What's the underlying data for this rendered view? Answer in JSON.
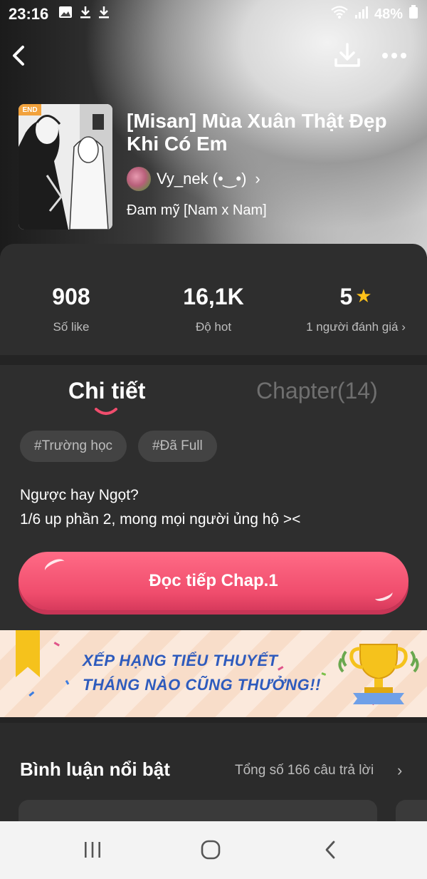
{
  "status_bar": {
    "time": "23:16",
    "battery": "48%",
    "icons": [
      "image-icon",
      "download-icon",
      "download-icon",
      "wifi-icon",
      "signal-icon",
      "lock-icon"
    ]
  },
  "topbar": {
    "icons": [
      "back-icon",
      "download-icon",
      "more-icon"
    ]
  },
  "story": {
    "cover_badge": "END",
    "title": "[Misan] Mùa Xuân Thật Đẹp Khi Có Em",
    "author": "Vy_nek (•‿•)",
    "author_chevron": "›",
    "genre": "Đam mỹ [Nam x Nam]"
  },
  "stats": {
    "likes": {
      "value": "908",
      "label": "Số like"
    },
    "hot": {
      "value": "16,1K",
      "label": "Độ hot"
    },
    "rating": {
      "value": "5",
      "star": "★",
      "label": "1 người đánh giá ›"
    }
  },
  "tabs": {
    "detail": "Chi tiết",
    "chapter": "Chapter(14)"
  },
  "tags": [
    "#Trường học",
    "#Đã Full"
  ],
  "description": {
    "line1": "Ngược hay Ngọt?",
    "line2": "1/6 up phần 2, mong mọi người ủng hộ ><"
  },
  "read_button": "Đọc tiếp Chap.1",
  "banner": {
    "line1": "XẾP HẠNG TIỂU THUYẾT",
    "line2": "THÁNG NÀO CŨNG THƯỞNG!!"
  },
  "comments": {
    "title": "Bình luận nổi bật",
    "total": "Tổng số 166 câu trả lời",
    "chevron": "›"
  },
  "colors": {
    "accent": "#f04d6d",
    "star": "#ffc21a",
    "banner_text": "#2e5bbd",
    "background": "#2b2b2b"
  }
}
